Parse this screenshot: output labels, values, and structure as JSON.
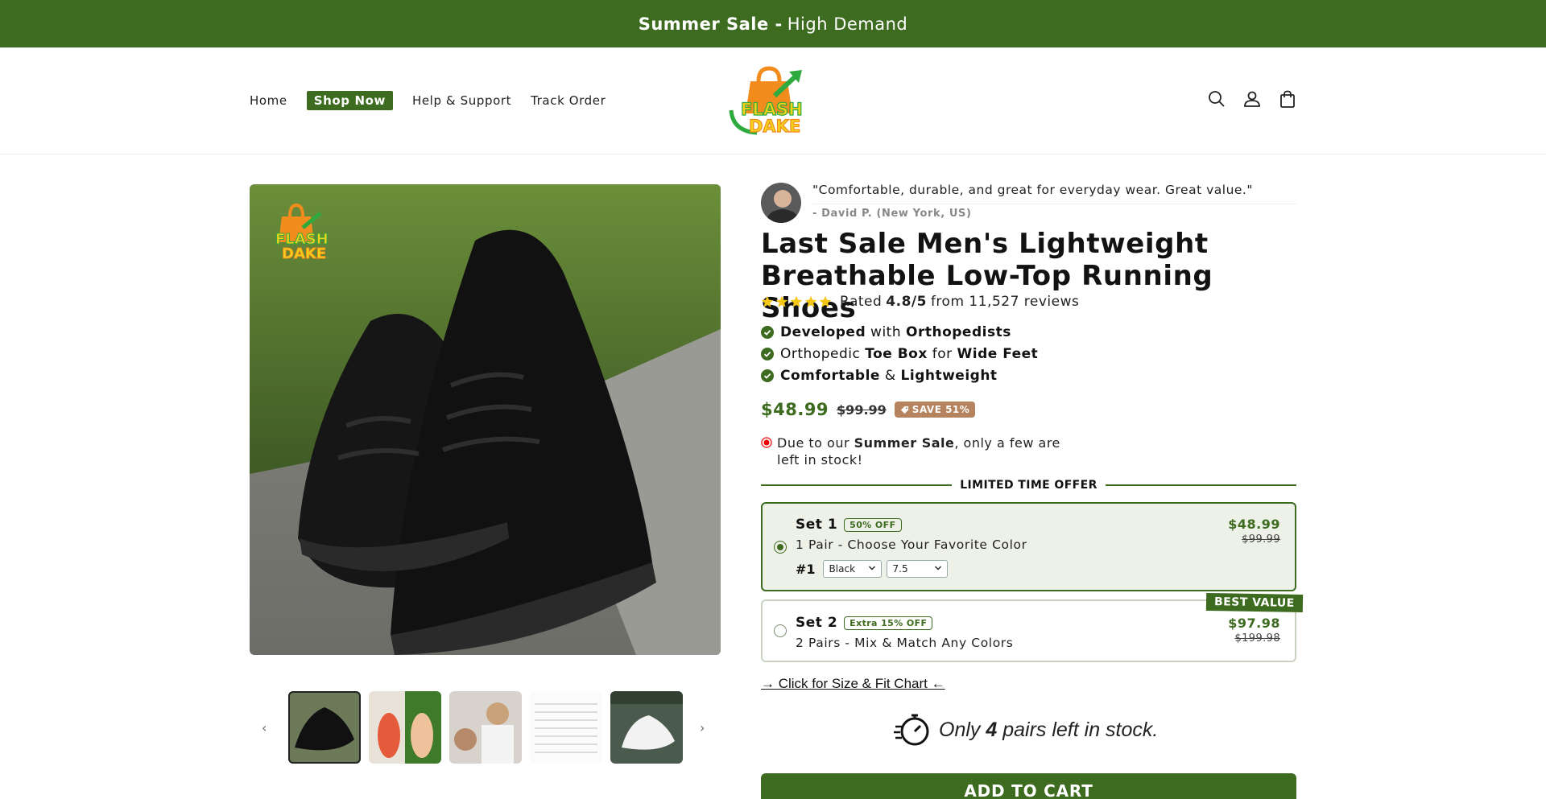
{
  "announcement": {
    "bold": "Summer Sale -",
    "text": "High Demand"
  },
  "nav": {
    "home": "Home",
    "shop_now": "Shop Now",
    "help": "Help & Support",
    "track": "Track Order"
  },
  "brand": {
    "logo_line1": "FLASH",
    "logo_line2": "DAKE"
  },
  "header_icons": [
    "search-icon",
    "account-icon",
    "cart-icon"
  ],
  "gallery": {
    "prev_arrow": "‹",
    "next_arrow": "›"
  },
  "review": {
    "quote": "\"Comfortable, durable, and great for everyday wear. Great value.\"",
    "author": "- David P. (New York, US)"
  },
  "product": {
    "title": " Last Sale  Men's Lightweight Breathable Low-Top Running Shoes",
    "rating_prefix": "Rated",
    "rating_value": "4.8/5",
    "rating_suffix": "from 11,527 reviews",
    "stars": 5,
    "features": [
      {
        "a": "Developed",
        "b": " with ",
        "c": "Orthopedists"
      },
      {
        "a": "Orthopedic ",
        "b": "Toe Box",
        "c": " for ",
        "d": "Wide Feet"
      },
      {
        "a": "Comfortable",
        "b": " & ",
        "c": "Lightweight"
      }
    ],
    "price": "$48.99",
    "compare_price": "$99.99",
    "save_badge": "SAVE 51%",
    "stock_msg_1": "Due to our ",
    "stock_msg_bold": "Summer Sale",
    "stock_msg_2": ", only a few are left in stock!"
  },
  "offer": {
    "header": "LIMITED TIME OFFER",
    "sets": [
      {
        "title": "Set 1",
        "pill": "50% OFF",
        "desc": "1 Pair - Choose Your Favorite Color",
        "price": "$48.99",
        "was": "$99.99",
        "variant_label": "#1",
        "color": "Black",
        "size": "7.5",
        "selected": true
      },
      {
        "title": "Set 2",
        "pill": "Extra 15% OFF",
        "desc": "2 Pairs - Mix & Match Any Colors",
        "price": "$97.98",
        "was": "$199.98",
        "badge": "BEST VALUE",
        "selected": false
      }
    ]
  },
  "size_chart_link": "→ Click for Size & Fit Chart ←",
  "low_stock": {
    "pre": "Only ",
    "num": "4",
    "post": " pairs left in stock."
  },
  "add_to_cart": "ADD TO CART",
  "colors": {
    "brand_green": "#3d6b1f",
    "save_badge": "#b5835d",
    "star": "#f5c518"
  }
}
